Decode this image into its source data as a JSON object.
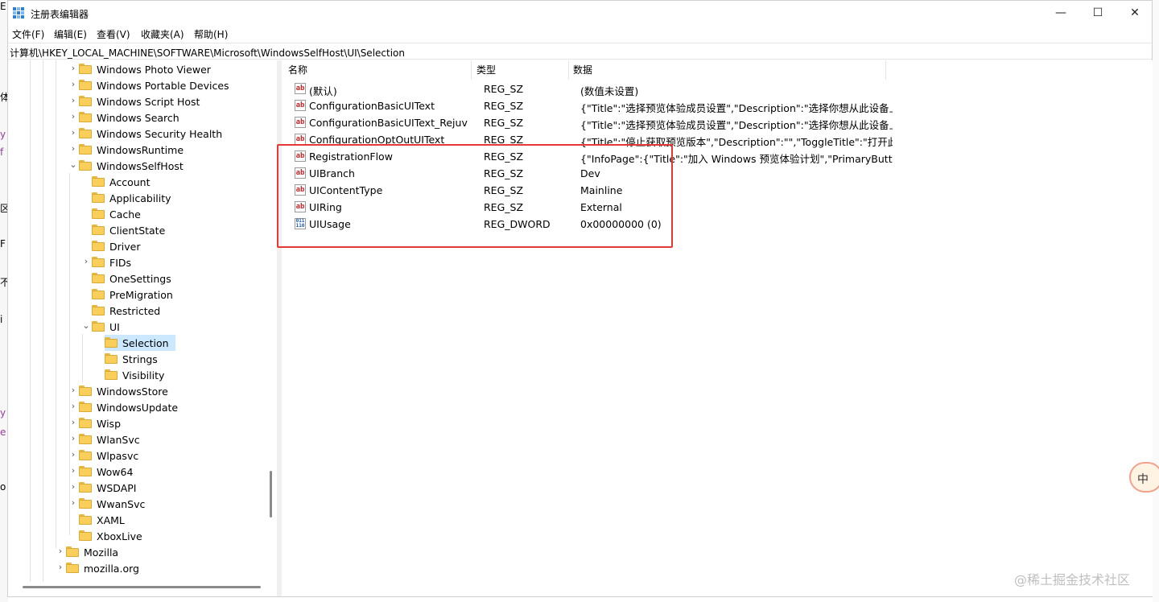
{
  "window": {
    "title": "注册表编辑器",
    "minimize_glyph": "—",
    "maximize_glyph": "☐",
    "close_glyph": "✕"
  },
  "menu": [
    "文件(F)",
    "编辑(E)",
    "查看(V)",
    "收藏夹(A)",
    "帮助(H)"
  ],
  "address": "计算机\\HKEY_LOCAL_MACHINE\\SOFTWARE\\Microsoft\\WindowsSelfHost\\UI\\Selection",
  "tree": {
    "nodes": [
      {
        "label": "Windows Photo Viewer",
        "chevron": "›"
      },
      {
        "label": "Windows Portable Devices",
        "chevron": "›"
      },
      {
        "label": "Windows Script Host",
        "chevron": "›"
      },
      {
        "label": "Windows Search",
        "chevron": "›"
      },
      {
        "label": "Windows Security Health",
        "chevron": "›"
      },
      {
        "label": "WindowsRuntime",
        "chevron": "›"
      },
      {
        "label": "WindowsSelfHost",
        "chevron": "⌄"
      },
      {
        "label": "Account",
        "chevron": ""
      },
      {
        "label": "Applicability",
        "chevron": ""
      },
      {
        "label": "Cache",
        "chevron": ""
      },
      {
        "label": "ClientState",
        "chevron": ""
      },
      {
        "label": "Driver",
        "chevron": ""
      },
      {
        "label": "FIDs",
        "chevron": "›"
      },
      {
        "label": "OneSettings",
        "chevron": ""
      },
      {
        "label": "PreMigration",
        "chevron": ""
      },
      {
        "label": "Restricted",
        "chevron": ""
      },
      {
        "label": "UI",
        "chevron": "⌄"
      },
      {
        "label": "Selection",
        "chevron": ""
      },
      {
        "label": "Strings",
        "chevron": ""
      },
      {
        "label": "Visibility",
        "chevron": ""
      },
      {
        "label": "WindowsStore",
        "chevron": "›"
      },
      {
        "label": "WindowsUpdate",
        "chevron": "›"
      },
      {
        "label": "Wisp",
        "chevron": "›"
      },
      {
        "label": "WlanSvc",
        "chevron": "›"
      },
      {
        "label": "Wlpasvc",
        "chevron": "›"
      },
      {
        "label": "Wow64",
        "chevron": "›"
      },
      {
        "label": "WSDAPI",
        "chevron": "›"
      },
      {
        "label": "WwanSvc",
        "chevron": "›"
      },
      {
        "label": "XAML",
        "chevron": ""
      },
      {
        "label": "XboxLive",
        "chevron": ""
      },
      {
        "label": "Mozilla",
        "chevron": "›"
      },
      {
        "label": "mozilla.org",
        "chevron": "›"
      }
    ],
    "selected": "Selection"
  },
  "values": {
    "headers": [
      "名称",
      "类型",
      "数据"
    ],
    "rows": [
      {
        "icon": "string-value-icon",
        "name": "(默认)",
        "type": "REG_SZ",
        "data": "(数值未设置)"
      },
      {
        "icon": "string-value-icon",
        "name": "ConfigurationBasicUIText",
        "type": "REG_SZ",
        "data": "{\"Title\":\"选择预览体验成员设置\",\"Description\":\"选择你想从此设备上..."
      },
      {
        "icon": "string-value-icon",
        "name": "ConfigurationBasicUIText_Rejuv",
        "type": "REG_SZ",
        "data": "{\"Title\":\"选择预览体验成员设置\",\"Description\":\"选择你想从此设备上..."
      },
      {
        "icon": "string-value-icon",
        "name": "ConfigurationOptOutUIText",
        "type": "REG_SZ",
        "data": "{\"Title\":\"停止获取预览版本\",\"Description\":\"\",\"ToggleTitle\":\"打开此项..."
      },
      {
        "icon": "string-value-icon",
        "name": "RegistrationFlow",
        "type": "REG_SZ",
        "data": "{\"InfoPage\":{\"Title\":\"加入 Windows 预览体验计划\",\"PrimaryButtonT..."
      },
      {
        "icon": "string-value-icon",
        "name": "UIBranch",
        "type": "REG_SZ",
        "data": "Dev"
      },
      {
        "icon": "string-value-icon",
        "name": "UIContentType",
        "type": "REG_SZ",
        "data": "Mainline"
      },
      {
        "icon": "string-value-icon",
        "name": "UIRing",
        "type": "REG_SZ",
        "data": "External"
      },
      {
        "icon": "dword-value-icon",
        "name": "UIUsage",
        "type": "REG_DWORD",
        "data": "0x00000000 (0)"
      }
    ]
  },
  "icons": {
    "string_glyph": "ab",
    "dword_glyph": "011 110"
  },
  "ime_indicator": "中",
  "watermark": "@稀土掘金技术社区",
  "background_fragments": [
    "E",
    "体",
    "y",
    "f",
    "区",
    "F",
    "不",
    "i",
    "y",
    "e",
    "o"
  ],
  "colors": {
    "selection": "#cce8ff",
    "highlight": "#e53935",
    "folder": "#f8cf5b"
  }
}
